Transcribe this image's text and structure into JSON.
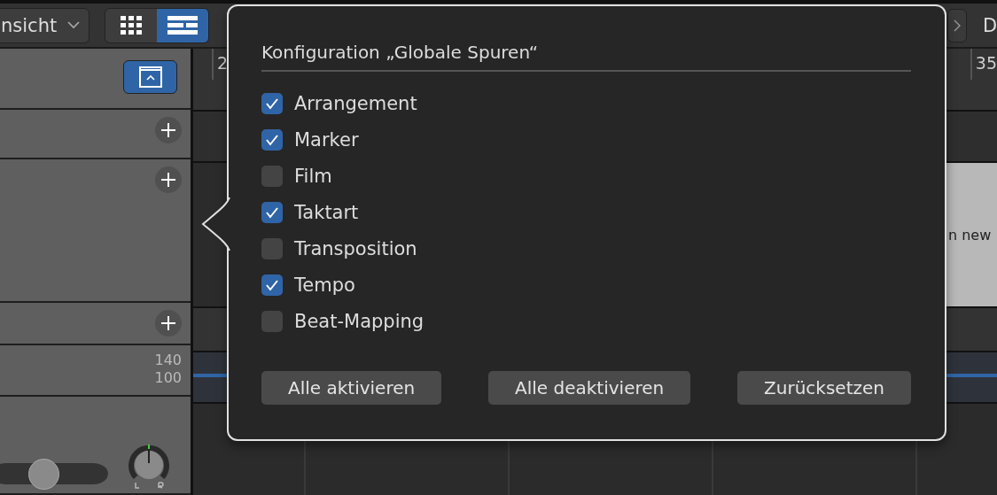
{
  "toolbar": {
    "view_menu": {
      "label": "nsicht"
    },
    "view_toggle": [
      {
        "kind": "grid",
        "selected": false
      },
      {
        "kind": "list",
        "selected": true
      }
    ],
    "right_label": "D"
  },
  "track_headers": [
    {
      "kind": "collapse"
    },
    {
      "kind": "add"
    },
    {
      "kind": "add"
    },
    {
      "kind": "add"
    },
    {
      "kind": "tempo",
      "values": [
        "140",
        "100"
      ]
    },
    {
      "kind": "mixer",
      "level": 0.45
    }
  ],
  "ruler": {
    "labels": [
      "2",
      "35"
    ]
  },
  "region_text": "n new",
  "popover": {
    "title": "Konfiguration „Globale Spuren“",
    "items": [
      {
        "label": "Arrangement",
        "checked": true
      },
      {
        "label": "Marker",
        "checked": true
      },
      {
        "label": "Film",
        "checked": false
      },
      {
        "label": "Taktart",
        "checked": true
      },
      {
        "label": "Transposition",
        "checked": false
      },
      {
        "label": "Tempo",
        "checked": true
      },
      {
        "label": "Beat-Mapping",
        "checked": false
      }
    ],
    "buttons": [
      "Alle aktivieren",
      "Alle deaktivieren",
      "Zurücksetzen"
    ]
  }
}
